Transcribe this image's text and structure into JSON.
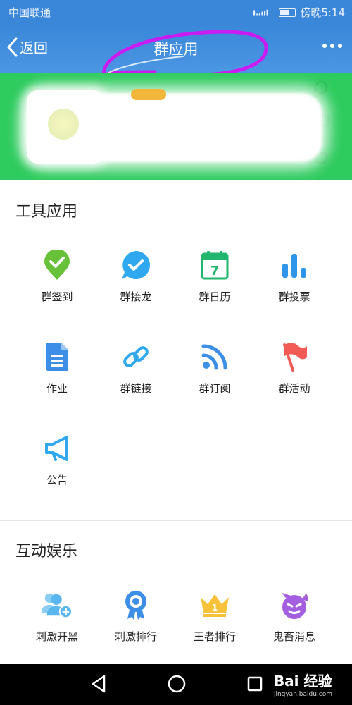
{
  "status_bar": {
    "carrier": "中国联通",
    "time": "傍晚5:14"
  },
  "title_bar": {
    "back_label": "返回",
    "title": "群应用"
  },
  "sections": [
    {
      "title": "工具应用",
      "items": [
        {
          "label": "群签到",
          "icon": "location-check-icon",
          "color": "#67c23a"
        },
        {
          "label": "群接龙",
          "icon": "chat-check-icon",
          "color": "#2fa8ef"
        },
        {
          "label": "群日历",
          "icon": "calendar-icon",
          "color": "#22b66e",
          "calendar_day": "7"
        },
        {
          "label": "群投票",
          "icon": "bar-chart-icon",
          "color": "#2f95e8"
        },
        {
          "label": "作业",
          "icon": "document-icon",
          "color": "#3d8ee6"
        },
        {
          "label": "群链接",
          "icon": "link-icon",
          "color": "#2fa8ef"
        },
        {
          "label": "群订阅",
          "icon": "rss-icon",
          "color": "#3d8ee6"
        },
        {
          "label": "群活动",
          "icon": "flag-icon",
          "color": "#f25a55"
        },
        {
          "label": "公告",
          "icon": "megaphone-icon",
          "color": "#2fa8ef"
        }
      ]
    },
    {
      "title": "互动娱乐",
      "items": [
        {
          "label": "刺激开黑",
          "icon": "add-team-icon",
          "color": "#5ab7ee"
        },
        {
          "label": "刺激排行",
          "icon": "medal-icon",
          "color": "#3d8ee6"
        },
        {
          "label": "王者排行",
          "icon": "crown-icon",
          "color": "#f7c23a",
          "crown_number": "1"
        },
        {
          "label": "鬼畜消息",
          "icon": "devil-face-icon",
          "color": "#a35fe0"
        }
      ]
    }
  ],
  "watermark": {
    "brand": "Bai 经验",
    "url": "jingyan.baidu.com"
  }
}
